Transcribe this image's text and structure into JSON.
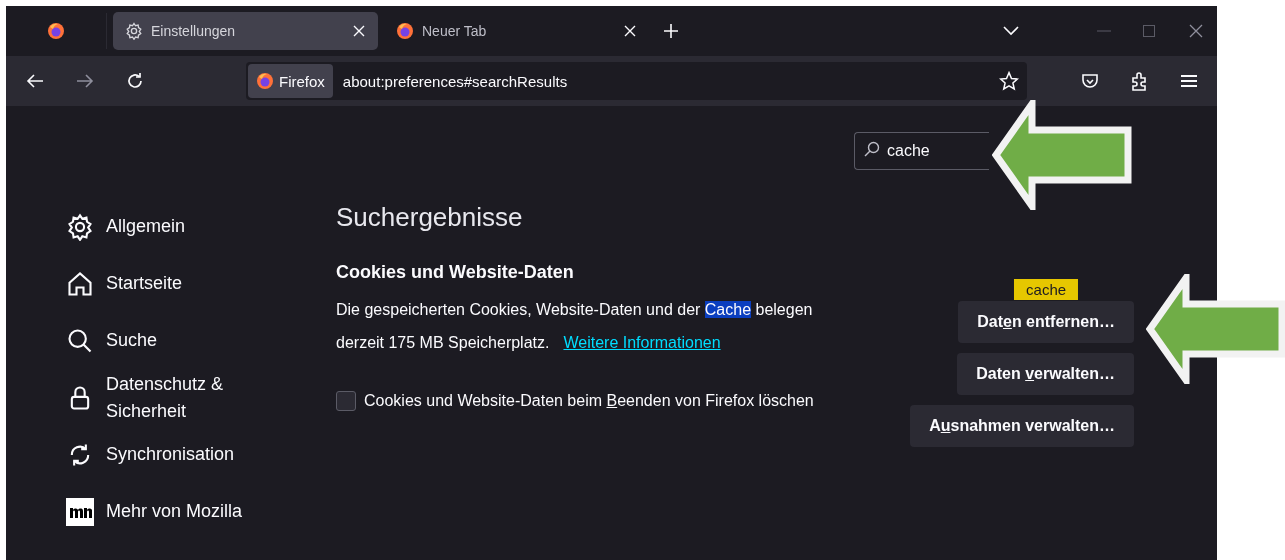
{
  "tabs": [
    {
      "label": "Einstellungen",
      "kind": "gear",
      "selected": true
    },
    {
      "label": "Neuer Tab",
      "kind": "firefox",
      "selected": false
    }
  ],
  "address_bar": {
    "identity": "Firefox",
    "url": "about:preferences#searchResults"
  },
  "search": {
    "value": "cache"
  },
  "sidebar": {
    "items": [
      {
        "label": "Allgemein",
        "kind": "gear"
      },
      {
        "label": "Startseite",
        "kind": "home"
      },
      {
        "label": "Suche",
        "kind": "search"
      },
      {
        "label": "Datenschutz & Sicherheit",
        "kind": "lock"
      },
      {
        "label": "Synchronisation",
        "kind": "sync"
      },
      {
        "label": "Mehr von Mozilla",
        "kind": "mozilla"
      }
    ]
  },
  "heading": "Suchergebnisse",
  "section": {
    "title": "Cookies und Website-Daten",
    "description": {
      "before": "Die gespeicherten Cookies, Website-Daten und der ",
      "highlight": "Cache",
      "after": " belegen derzeit 175 MB Speicherplatz."
    },
    "link": "Weitere Informationen",
    "checkbox": {
      "label_parts": [
        "Cookies und Website-Daten beim ",
        "B",
        "eenden von Firefox löschen"
      ],
      "checked": false
    }
  },
  "buttons": [
    {
      "label_parts": [
        "Dat",
        "e",
        "n entfernen…"
      ],
      "tooltip": "cache"
    },
    {
      "label_parts": [
        "Daten ",
        "v",
        "erwalten…"
      ]
    },
    {
      "label_parts": [
        "A",
        "u",
        "snahmen verwalten…"
      ]
    }
  ]
}
